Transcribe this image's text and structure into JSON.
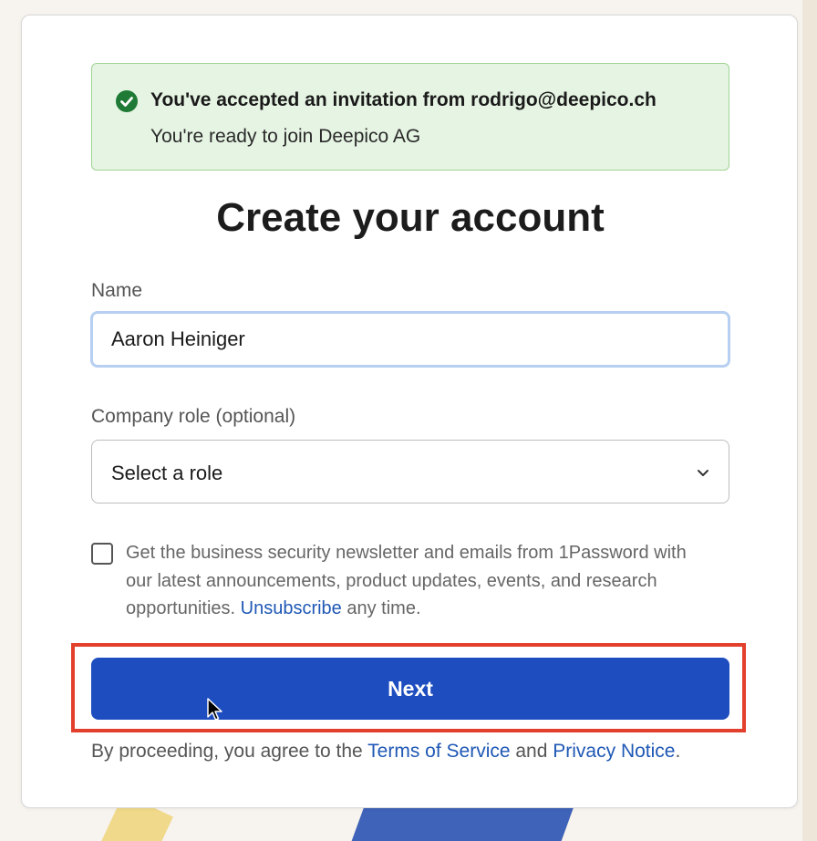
{
  "invitation": {
    "title": "You've accepted an invitation from rodrigo@deepico.ch",
    "subtitle": "You're ready to join Deepico AG",
    "icon": "check-circle-icon"
  },
  "page_title": "Create your account",
  "name_field": {
    "label": "Name",
    "value": "Aaron Heiniger"
  },
  "role_field": {
    "label": "Company role (optional)",
    "selected": "Select a role",
    "icon": "chevron-down-icon"
  },
  "newsletter": {
    "checked": false,
    "text_before": "Get the business security newsletter and emails from 1Password with our latest announcements, product updates, events, and research opportunities. ",
    "link": "Unsubscribe",
    "text_after": " any time."
  },
  "next_button": {
    "label": "Next"
  },
  "agreement": {
    "prefix": "By proceeding, you agree to the ",
    "terms_link": "Terms of Service",
    "middle": " and ",
    "privacy_link": "Privacy Notice",
    "suffix": "."
  },
  "colors": {
    "primary_button": "#1e4dbf",
    "success_bg": "#e6f4e3",
    "success_border": "#9fd394",
    "success_icon": "#1f7a35",
    "link": "#1f58b5",
    "highlight": "#e2402c"
  }
}
